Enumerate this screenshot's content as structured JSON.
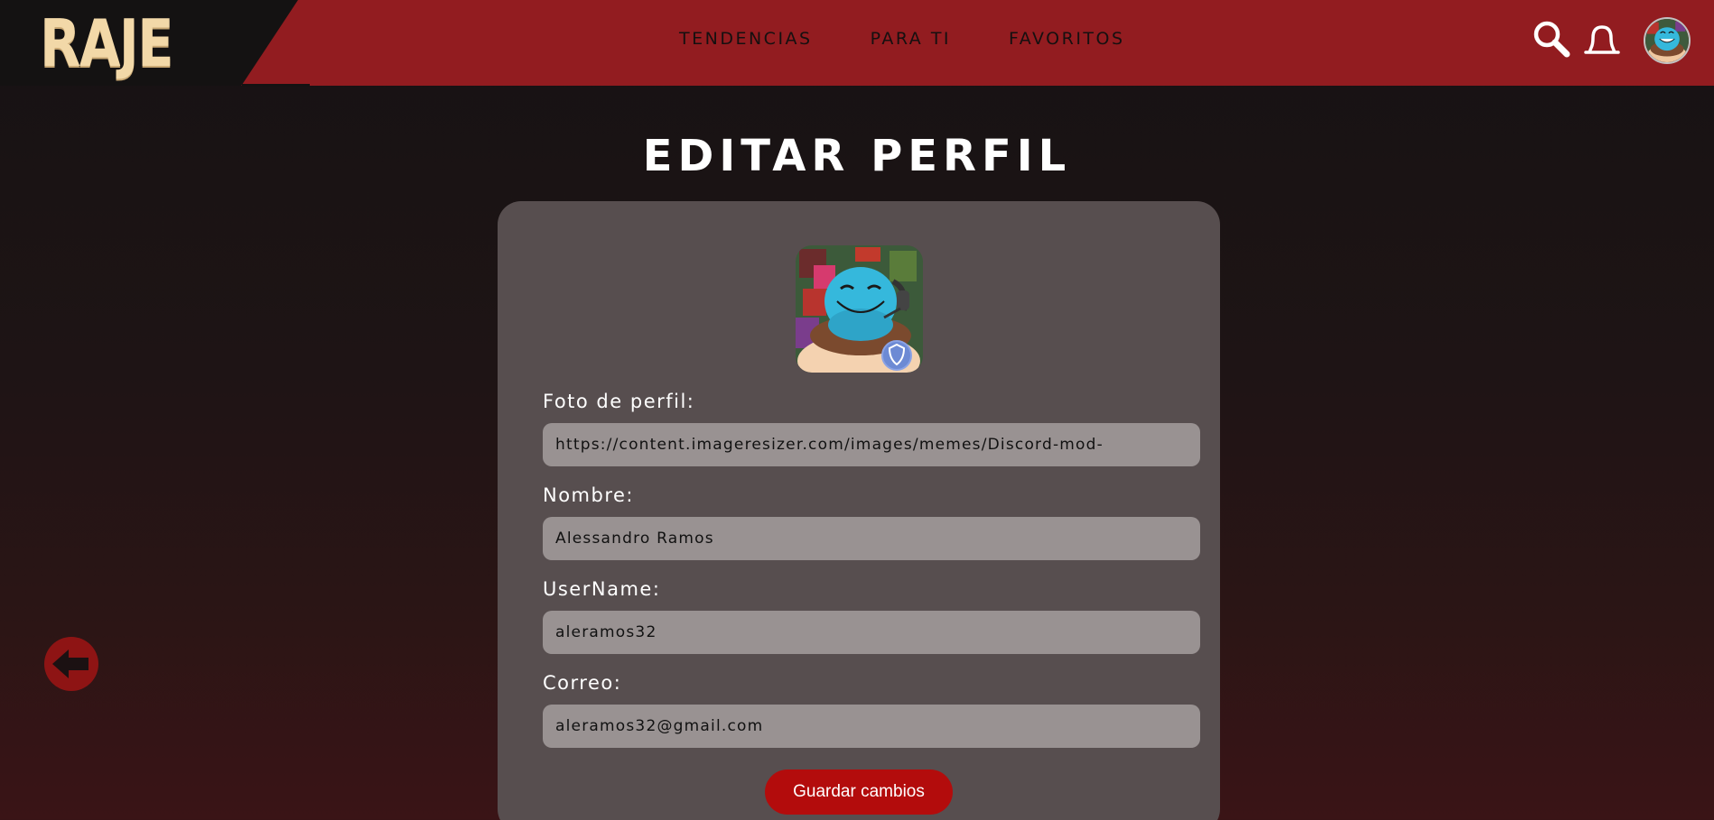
{
  "brand": {
    "logo": "RAJE"
  },
  "nav": {
    "links": [
      "TENDENCIAS",
      "PARA TI",
      "FAVORITOS"
    ]
  },
  "header_icons": [
    "search-icon",
    "notification-bell-icon",
    "user-avatar"
  ],
  "page": {
    "title": "EDITAR PERFIL"
  },
  "form": {
    "photo_label": "Foto de perfil:",
    "photo_value": "https://content.imageresizer.com/images/memes/Discord-mod-",
    "name_label": "Nombre:",
    "name_value": "Alessandro Ramos",
    "username_label": "UserName:",
    "username_value": "aleramos32",
    "email_label": "Correo:",
    "email_value": "aleramos32@gmail.com",
    "save_label": "Guardar cambios"
  },
  "colors": {
    "header_red": "#921c20",
    "logo_bg": "#141212",
    "logo_text": "#f2d8a8",
    "card_bg": "#574e4f",
    "input_bg": "#999292",
    "save_button": "#b30c0c",
    "back_button": "#8e1414"
  }
}
